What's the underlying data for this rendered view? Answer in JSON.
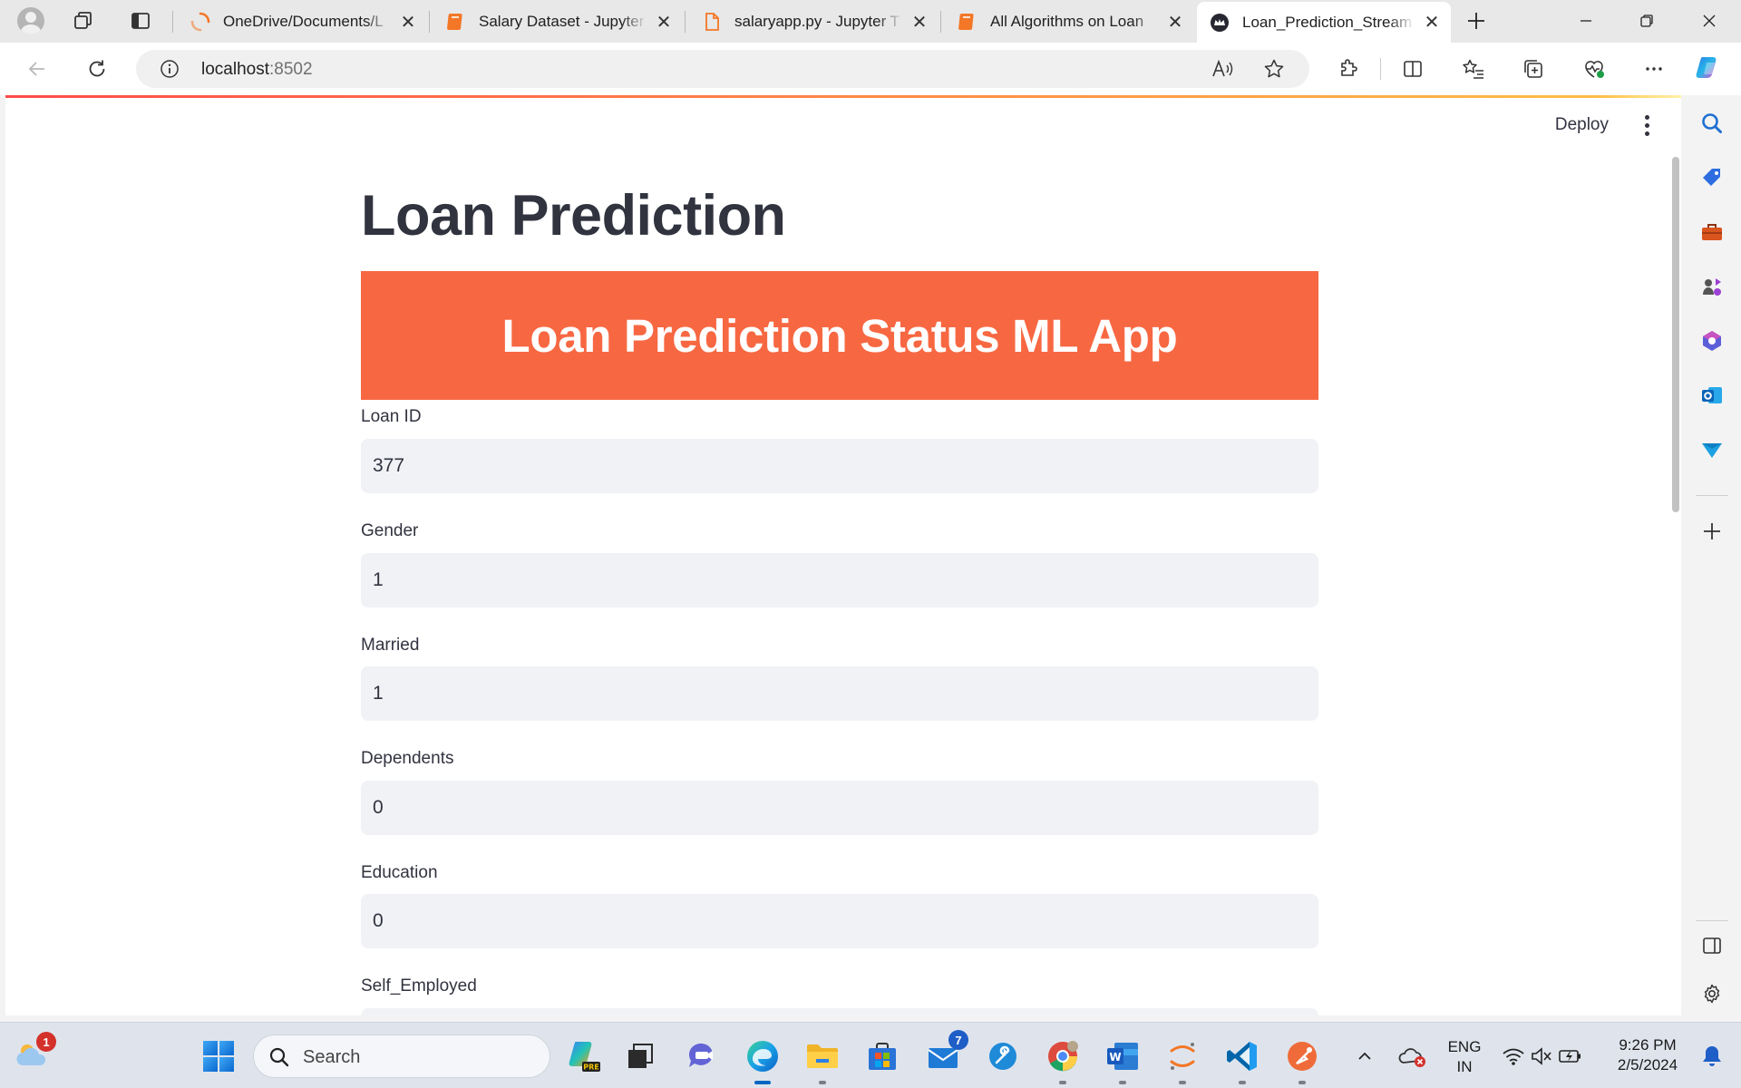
{
  "browser": {
    "tabs": [
      {
        "title": "OneDrive/Documents/L",
        "active": false
      },
      {
        "title": "Salary Dataset - Jupyter",
        "active": false
      },
      {
        "title": "salaryapp.py - Jupyter T",
        "active": false
      },
      {
        "title": "All Algorithms on Loan",
        "active": false
      },
      {
        "title": "Loan_Prediction_Stream",
        "active": true
      }
    ],
    "address": {
      "host": "localhost",
      "port": ":8502"
    }
  },
  "app": {
    "deploy_label": "Deploy",
    "title": "Loan Prediction",
    "banner": "Loan Prediction Status ML App",
    "fields": [
      {
        "label": "Loan ID",
        "value": "377"
      },
      {
        "label": "Gender",
        "value": "1"
      },
      {
        "label": "Married",
        "value": "1"
      },
      {
        "label": "Dependents",
        "value": "0"
      },
      {
        "label": "Education",
        "value": "0"
      },
      {
        "label": "Self_Employed",
        "value": ""
      }
    ],
    "colors": {
      "banner": "#f76842",
      "input_bg": "#f0f2f6",
      "text": "#31333f"
    }
  },
  "taskbar": {
    "weather_badge": "1",
    "search_label": "Search",
    "mail_badge": "7",
    "lang_line1": "ENG",
    "lang_line2": "IN",
    "time": "9:26 PM",
    "date": "2/5/2024"
  }
}
